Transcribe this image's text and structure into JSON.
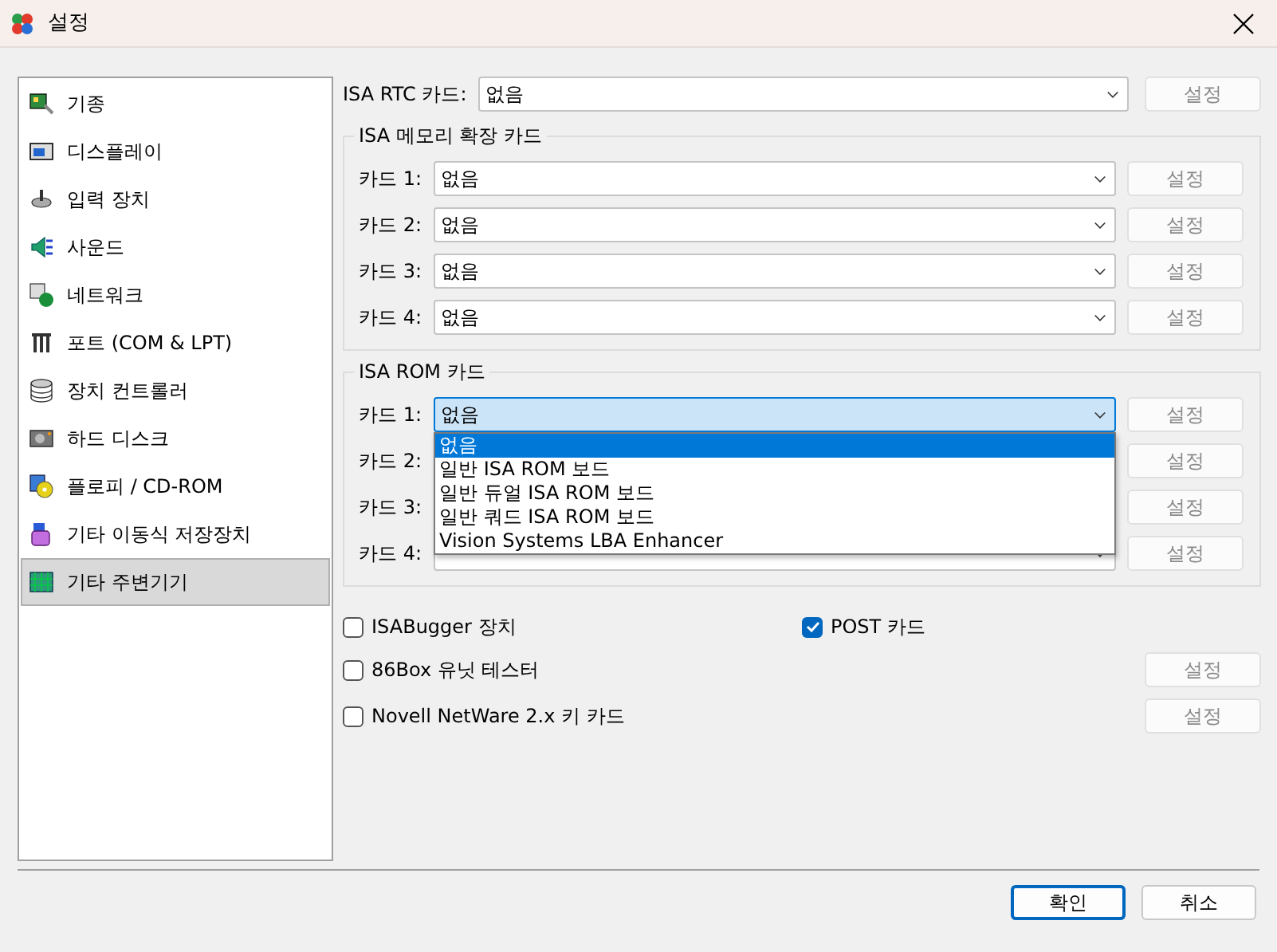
{
  "window": {
    "title": "설정"
  },
  "sidebar": {
    "items": [
      {
        "label": "기종",
        "selected": false
      },
      {
        "label": "디스플레이",
        "selected": false
      },
      {
        "label": "입력 장치",
        "selected": false
      },
      {
        "label": "사운드",
        "selected": false
      },
      {
        "label": "네트워크",
        "selected": false
      },
      {
        "label": "포트 (COM & LPT)",
        "selected": false
      },
      {
        "label": "장치 컨트롤러",
        "selected": false
      },
      {
        "label": "하드 디스크",
        "selected": false
      },
      {
        "label": "플로피 / CD-ROM",
        "selected": false
      },
      {
        "label": "기타 이동식 저장장치",
        "selected": false
      },
      {
        "label": "기타 주변기기",
        "selected": true
      }
    ]
  },
  "rtc": {
    "label": "ISA RTC 카드:",
    "value": "없음",
    "button": {
      "label": "설정",
      "disabled": true
    }
  },
  "groups": [
    {
      "title": "ISA 메모리 확장 카드",
      "cards": [
        {
          "kind": "combo",
          "label": "카드 1:",
          "value": "없음",
          "button": {
            "label": "설정",
            "disabled": true
          }
        },
        {
          "kind": "combo",
          "label": "카드 2:",
          "value": "없음",
          "button": {
            "label": "설정",
            "disabled": true
          }
        },
        {
          "kind": "combo",
          "label": "카드 3:",
          "value": "없음",
          "button": {
            "label": "설정",
            "disabled": true
          }
        },
        {
          "kind": "combo",
          "label": "카드 4:",
          "value": "없음",
          "button": {
            "label": "설정",
            "disabled": true
          }
        }
      ]
    },
    {
      "title": "ISA ROM 카드",
      "cards": [
        {
          "kind": "combo",
          "label": "카드 1:",
          "value": "없음",
          "button": {
            "label": "설정",
            "disabled": true
          },
          "options": [
            {
              "label": "없음",
              "selected": true
            },
            {
              "label": "일반 ISA ROM 보드",
              "selected": false
            },
            {
              "label": "일반 듀얼 ISA ROM 보드",
              "selected": false
            },
            {
              "label": "일반 쿼드 ISA ROM 보드",
              "selected": false
            },
            {
              "label": "Vision Systems LBA Enhancer",
              "selected": false
            }
          ]
        },
        {
          "kind": "covered",
          "label": "카드 2:",
          "button": {
            "label": "설정",
            "disabled": true
          }
        },
        {
          "kind": "covered",
          "label": "카드 3:",
          "button": {
            "label": "설정",
            "disabled": true
          }
        },
        {
          "kind": "combo",
          "label": "카드 4:",
          "button": {
            "label": "설정",
            "disabled": true
          }
        }
      ]
    }
  ],
  "option_rows": [
    [
      {
        "label": "ISABugger 장치",
        "checked": false
      },
      {
        "label": "POST 카드",
        "checked": true
      }
    ],
    [
      {
        "label": "86Box 유닛 테스터",
        "checked": false,
        "button": {
          "label": "설정",
          "disabled": true
        }
      }
    ],
    [
      {
        "label": "Novell NetWare 2.x 키 카드",
        "checked": false,
        "button": {
          "label": "설정",
          "disabled": true
        }
      }
    ]
  ],
  "buttons": [
    {
      "label": "확인",
      "default": true
    },
    {
      "label": "취소",
      "default": false
    }
  ]
}
